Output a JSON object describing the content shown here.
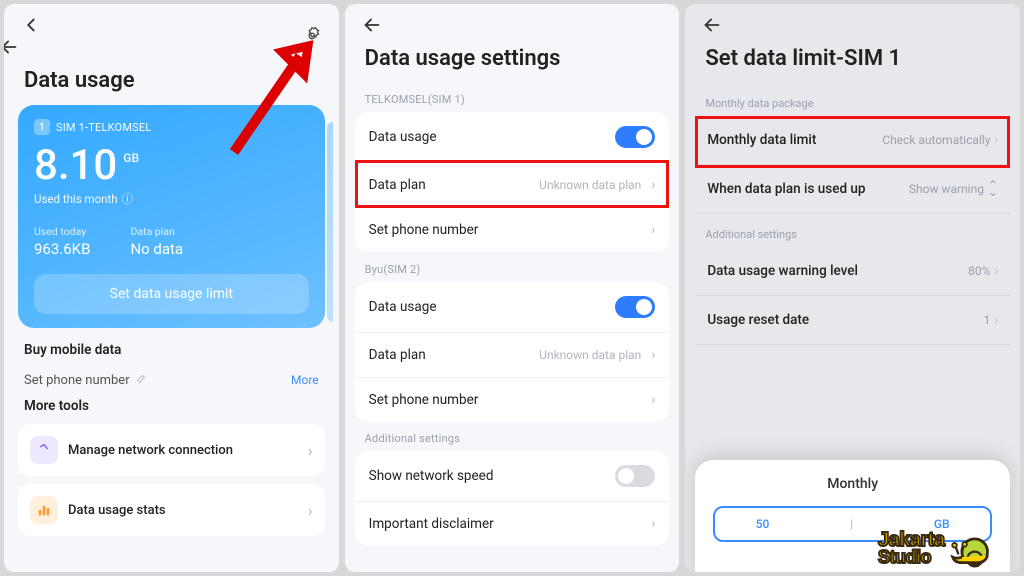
{
  "panel1": {
    "title": "Data usage",
    "sim_label": "SIM 1-TELKOMSEL",
    "usage_value": "8.10",
    "usage_unit": "GB",
    "used_this_month": "Used this month",
    "used_today_label": "Used today",
    "used_today_value": "963.6KB",
    "data_plan_label": "Data plan",
    "data_plan_value": "No data",
    "set_limit_btn": "Set data usage limit",
    "buy_title": "Buy mobile data",
    "set_phone_label": "Set phone number",
    "more_link": "More",
    "more_tools": "More tools",
    "tool_network": "Manage network connection",
    "tool_stats": "Data usage stats"
  },
  "panel2": {
    "title": "Data usage settings",
    "sim1_group": "TELKOMSEL(SIM 1)",
    "sim2_group": "Byu(SIM 2)",
    "addl_group": "Additional settings",
    "row_data_usage": "Data usage",
    "row_data_plan": "Data plan",
    "row_data_plan_val": "Unknown data plan",
    "row_set_phone": "Set phone number",
    "row_show_speed": "Show network speed",
    "row_disclaimer": "Important disclaimer"
  },
  "panel3": {
    "title": "Set data limit-SIM 1",
    "group_monthly": "Monthly data package",
    "row_monthly_limit": "Monthly data limit",
    "row_monthly_limit_val": "Check automatically",
    "row_used_up": "When data plan is used up",
    "row_used_up_val": "Show warning",
    "group_addl": "Additional settings",
    "row_warning": "Data usage warning level",
    "row_warning_val": "80%",
    "row_reset": "Usage reset date",
    "row_reset_val": "1",
    "modal_title": "Monthly",
    "modal_val": "50",
    "modal_unit": "GB"
  },
  "logo": {
    "line1": "Jakarta",
    "line2": "Studio"
  }
}
